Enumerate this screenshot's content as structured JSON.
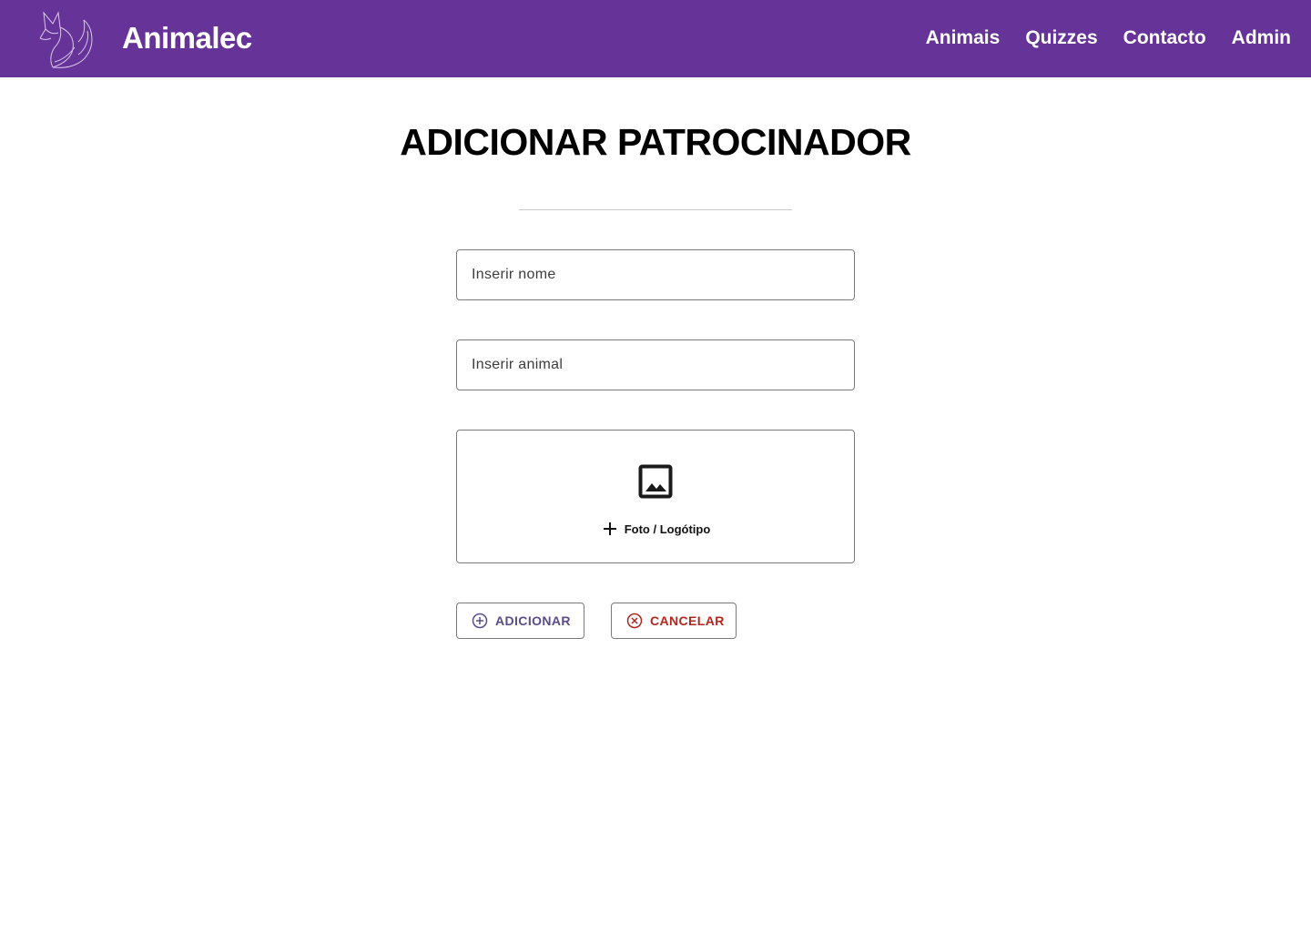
{
  "header": {
    "brand": "Animalec",
    "nav": [
      "Animais",
      "Quizzes",
      "Contacto",
      "Admin"
    ],
    "background_color": "#663399"
  },
  "main": {
    "title": "ADICIONAR PATROCINADOR",
    "fields": {
      "name_placeholder": "Inserir nome",
      "animal_placeholder": "Inserir animal"
    },
    "upload": {
      "label": "Foto / Logótipo",
      "icon": "image-icon"
    },
    "buttons": {
      "add_label": "ADICIONAR",
      "add_icon": "plus-circle-icon",
      "add_color": "#5b4b8a",
      "cancel_label": "CANCELAR",
      "cancel_icon": "x-circle-icon",
      "cancel_color": "#b3261e"
    }
  }
}
